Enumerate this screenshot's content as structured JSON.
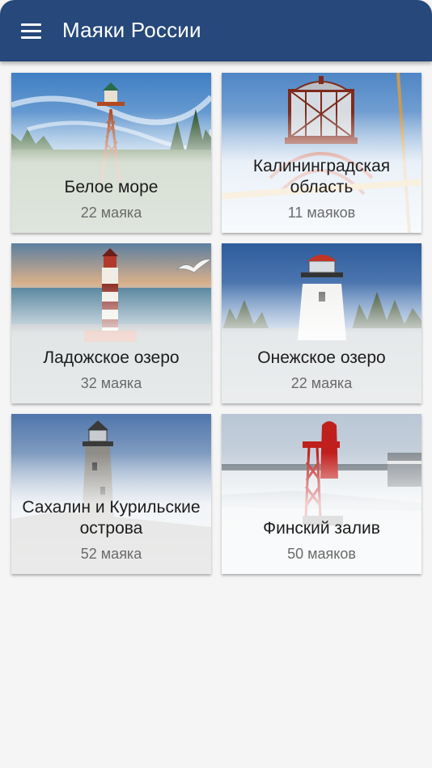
{
  "app_bar": {
    "title": "Маяки России",
    "menu_icon": "hamburger-menu-icon",
    "color": "#26487a"
  },
  "regions": [
    {
      "title": "Белое море",
      "count": "22 маяка"
    },
    {
      "title": "Калининградская область",
      "count": "11 маяков"
    },
    {
      "title": "Ладожское озеро",
      "count": "32 маяка"
    },
    {
      "title": "Онежское озеро",
      "count": "22 маяка"
    },
    {
      "title": "Сахалин и Курильские острова",
      "count": "52 маяка"
    },
    {
      "title": "Финский залив",
      "count": "50 маяков"
    }
  ]
}
